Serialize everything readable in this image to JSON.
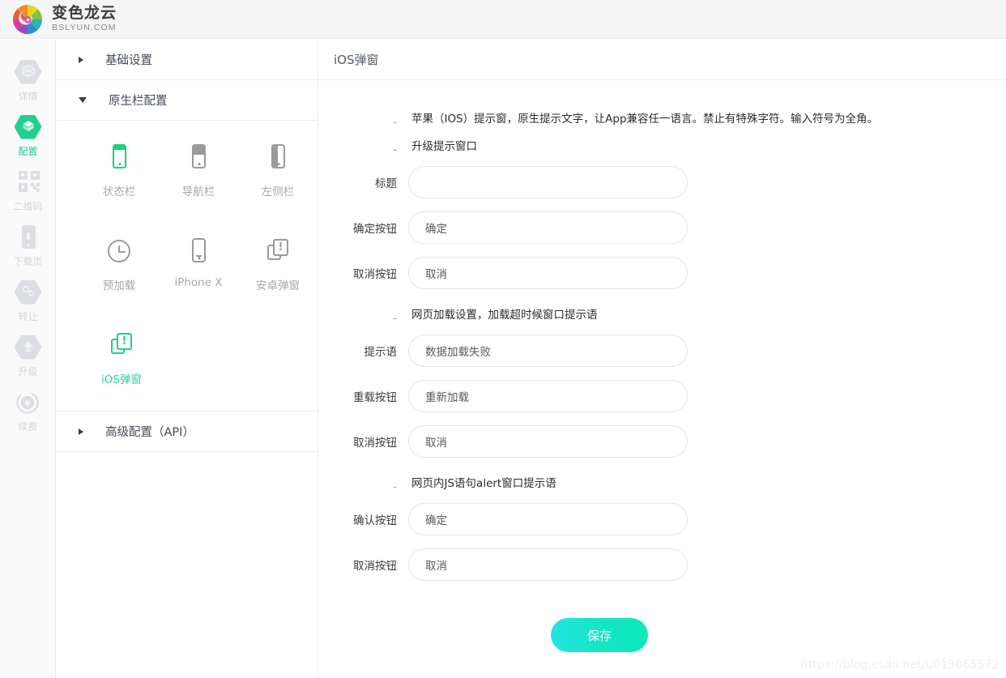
{
  "brand": {
    "name_cn": "变色龙云",
    "name_en": "BSLYUN.COM",
    "logo_icon": "chameleon-logo-icon"
  },
  "accent": {
    "green": "#1fd18d",
    "green_light": "#2dd396",
    "save_gradient_from": "#25e3e3",
    "save_gradient_to": "#0de8bb",
    "muted": "#d3d5da",
    "panel_border": "#e9e9e9"
  },
  "rail": {
    "items": [
      {
        "label": "详情",
        "icon": "hexagon-details-icon",
        "active": false
      },
      {
        "label": "配置",
        "icon": "hexagon-config-icon",
        "active": true
      },
      {
        "label": "二维码",
        "icon": "qrcode-icon",
        "active": false
      },
      {
        "label": "下载页",
        "icon": "phone-download-icon",
        "active": false
      },
      {
        "label": "转让",
        "icon": "hexagon-transfer-icon",
        "active": false
      },
      {
        "label": "升级",
        "icon": "hexagon-upgrade-icon",
        "active": false
      },
      {
        "label": "续费",
        "icon": "hexagon-renew-icon",
        "active": false
      }
    ]
  },
  "tree": {
    "groups": [
      {
        "title": "基础设置",
        "expanded": false,
        "icon": "triangle-right-icon"
      },
      {
        "title": "原生栏配置",
        "expanded": true,
        "icon": "triangle-down-icon"
      },
      {
        "title": "高级配置（API）",
        "expanded": false,
        "icon": "triangle-right-icon"
      }
    ],
    "tiles": [
      {
        "label": "状态栏",
        "icon": "phone-statusbar-icon",
        "active": false
      },
      {
        "label": "导航栏",
        "icon": "phone-navbar-icon",
        "active": false
      },
      {
        "label": "左侧栏",
        "icon": "phone-sidebar-icon",
        "active": false
      },
      {
        "label": "预加载",
        "icon": "clock-preload-icon",
        "active": false
      },
      {
        "label": "iPhone X",
        "icon": "phone-iphonex-icon",
        "active": false
      },
      {
        "label": "安卓弹窗",
        "icon": "android-alert-icon",
        "active": false
      },
      {
        "label": "iOS弹窗",
        "icon": "ios-alert-icon",
        "active": true
      }
    ]
  },
  "main": {
    "title": "iOS弹窗",
    "dash_label": "-",
    "notes": {
      "intro": "苹果（IOS）提示窗，原生提示文字，让App兼容任一语言。禁止有特殊字符。输入符号为全角。",
      "section_upgrade": "升级提示窗口",
      "section_loading": "网页加载设置，加载超时候窗口提示语",
      "section_alert": "网页内JS语句alert窗口提示语"
    },
    "fields": [
      {
        "label": "标题",
        "value": "",
        "placeholder": "",
        "name": "title-field"
      },
      {
        "label": "确定按钮",
        "value": "确定",
        "placeholder": "",
        "name": "confirm-button-field"
      },
      {
        "label": "取消按钮",
        "value": "取消",
        "placeholder": "",
        "name": "cancel-button-field"
      },
      {
        "label": "提示语",
        "value": "数据加载失败",
        "placeholder": "",
        "name": "loading-tip-field"
      },
      {
        "label": "重载按钮",
        "value": "重新加载",
        "placeholder": "",
        "name": "reload-button-field"
      },
      {
        "label": "取消按钮",
        "value": "取消",
        "placeholder": "",
        "name": "loading-cancel-field"
      },
      {
        "label": "确认按钮",
        "value": "确定",
        "placeholder": "",
        "name": "alert-confirm-field"
      },
      {
        "label": "取消按钮",
        "value": "取消",
        "placeholder": "",
        "name": "alert-cancel-field"
      }
    ],
    "save_label": "保存"
  },
  "watermark": "https://blog.csdn.net/u013065572"
}
